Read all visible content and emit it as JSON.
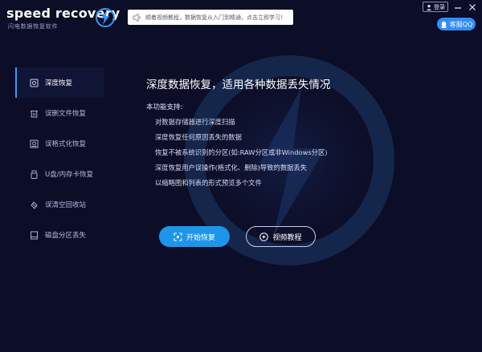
{
  "brand": {
    "title": "speed recovery",
    "subtitle": "闪电数据恢复软件"
  },
  "notice": {
    "text": "顺着视频教程，数据恢复从入门到精通，点击立即学习！"
  },
  "window": {
    "login_label": "登录"
  },
  "support": {
    "qq_label": "客服QQ"
  },
  "sidebar": {
    "items": [
      {
        "label": "深度恢复",
        "icon": "deep-recovery-icon",
        "active": true
      },
      {
        "label": "误删文件恢复",
        "icon": "trash-icon"
      },
      {
        "label": "误格式化恢复",
        "icon": "disk-format-icon"
      },
      {
        "label": "U盘/内存卡恢复",
        "icon": "usb-icon"
      },
      {
        "label": "误清空回收站",
        "icon": "recycle-icon"
      },
      {
        "label": "磁盘分区丢失",
        "icon": "partition-icon"
      }
    ]
  },
  "main": {
    "title": "深度数据恢复，适用各种数据丢失情况",
    "features_title": "本功能支持:",
    "features": [
      "对数据存储器进行深度扫描",
      "深度恢复任何原因丢失的数据",
      "恢复不被系统识别的分区(如:RAW分区或非Windows分区)",
      "深度恢复用户误操作(格式化、删除)导致的数据丢失",
      "以缩略图和列表的形式预览多个文件"
    ],
    "start_label": "开始恢复",
    "video_label": "视频教程"
  },
  "colors": {
    "background": "#0c0d26",
    "accent": "#1c96ea",
    "qq": "#2f8dff",
    "active_bar": "#2f9bff"
  }
}
